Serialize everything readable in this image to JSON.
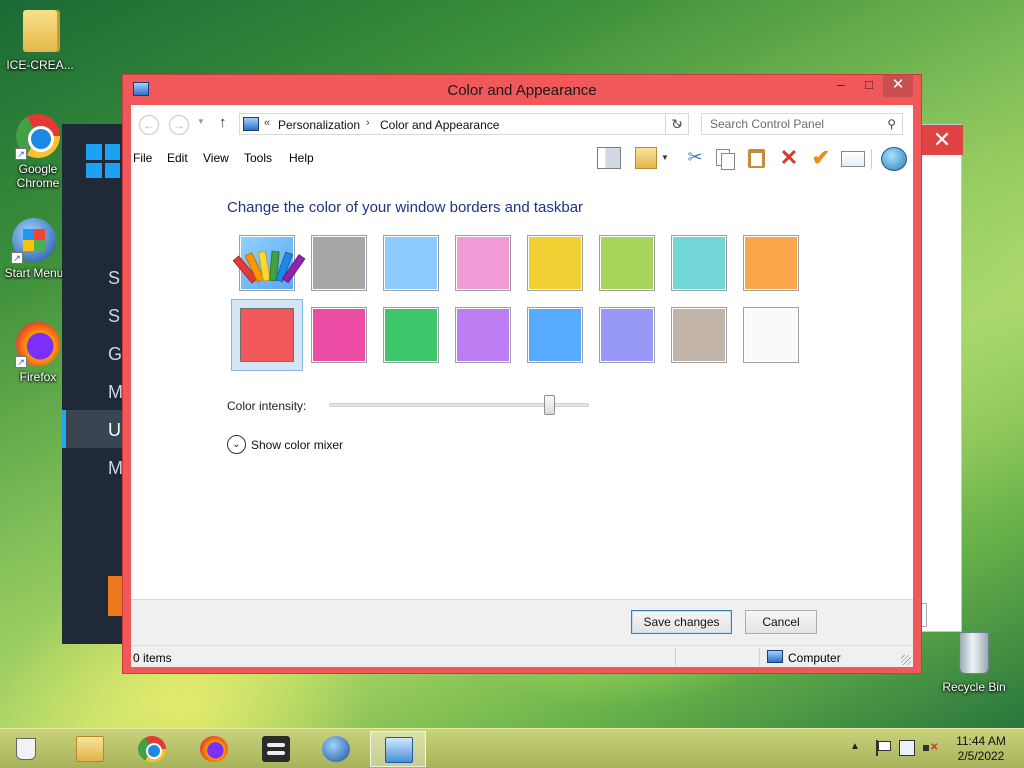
{
  "desktop": {
    "icons": [
      {
        "label": "ICE-CREA...",
        "icon": "folder-icon"
      },
      {
        "label": "Google Chrome",
        "icon": "chrome-icon"
      },
      {
        "label": "Start Menu",
        "icon": "windows-orb-icon"
      },
      {
        "label": "Firefox",
        "icon": "firefox-icon"
      },
      {
        "label": "Recycle Bin",
        "icon": "recycle-bin-icon"
      }
    ],
    "background_menu_letters": [
      "S",
      "S",
      "G",
      "M",
      "U",
      "M"
    ]
  },
  "window": {
    "title": "Color and Appearance",
    "controls": {
      "minimize": "–",
      "maximize": "□",
      "close": "✕"
    },
    "border_color": "#f0585a",
    "nav": {
      "back": "←",
      "forward": "→",
      "up": "↑",
      "breadcrumb_prefix": "«",
      "breadcrumbs": [
        "Personalization",
        "Color and Appearance"
      ],
      "breadcrumb_separator": "›",
      "refresh": "↻"
    },
    "search": {
      "placeholder": "Search Control Panel"
    },
    "menu": [
      "File",
      "Edit",
      "View",
      "Tools",
      "Help"
    ],
    "toolbar_icons": [
      "layout-icon",
      "properties-icon",
      "cut-icon",
      "copy-icon",
      "paste-icon",
      "delete-icon",
      "check-icon",
      "rename-icon",
      "globe-icon"
    ],
    "content": {
      "heading": "Change the color of your window borders and taskbar",
      "swatches": [
        {
          "name": "custom",
          "color": "#8fd2ff",
          "selected": false
        },
        {
          "name": "gray",
          "color": "#a6a6a6",
          "selected": false
        },
        {
          "name": "sky",
          "color": "#8ccbff",
          "selected": false
        },
        {
          "name": "pink",
          "color": "#f29bd6",
          "selected": false
        },
        {
          "name": "yellow",
          "color": "#f1d034",
          "selected": false
        },
        {
          "name": "lime",
          "color": "#a8d65a",
          "selected": false
        },
        {
          "name": "teal",
          "color": "#74d7d7",
          "selected": false
        },
        {
          "name": "orange",
          "color": "#fca64c",
          "selected": false
        },
        {
          "name": "red",
          "color": "#f0585a",
          "selected": true
        },
        {
          "name": "magenta",
          "color": "#ec4ca4",
          "selected": false
        },
        {
          "name": "green",
          "color": "#3ec76a",
          "selected": false
        },
        {
          "name": "purple",
          "color": "#bd7ef4",
          "selected": false
        },
        {
          "name": "blue",
          "color": "#56abff",
          "selected": false
        },
        {
          "name": "violet",
          "color": "#9898f7",
          "selected": false
        },
        {
          "name": "taupe",
          "color": "#c2b4a8",
          "selected": false
        },
        {
          "name": "white",
          "color": "#fafafa",
          "selected": false
        }
      ],
      "intensity_label": "Color intensity:",
      "intensity_value": 0.86,
      "mixer_label": "Show color mixer",
      "mixer_chevron": "⌄"
    },
    "buttons": {
      "save": "Save changes",
      "cancel": "Cancel"
    },
    "status": {
      "items": "0 items",
      "location": "Computer"
    }
  },
  "taskbar": {
    "apps": [
      "mug-icon",
      "file-explorer-icon",
      "chrome-icon",
      "firefox-icon",
      "switcher-icon",
      "start-orb-icon",
      "control-panel-icon"
    ],
    "active_app": "control-panel-icon",
    "tray_arrow": "▲",
    "clock": {
      "time": "11:44 AM",
      "date": "2/5/2022"
    }
  }
}
